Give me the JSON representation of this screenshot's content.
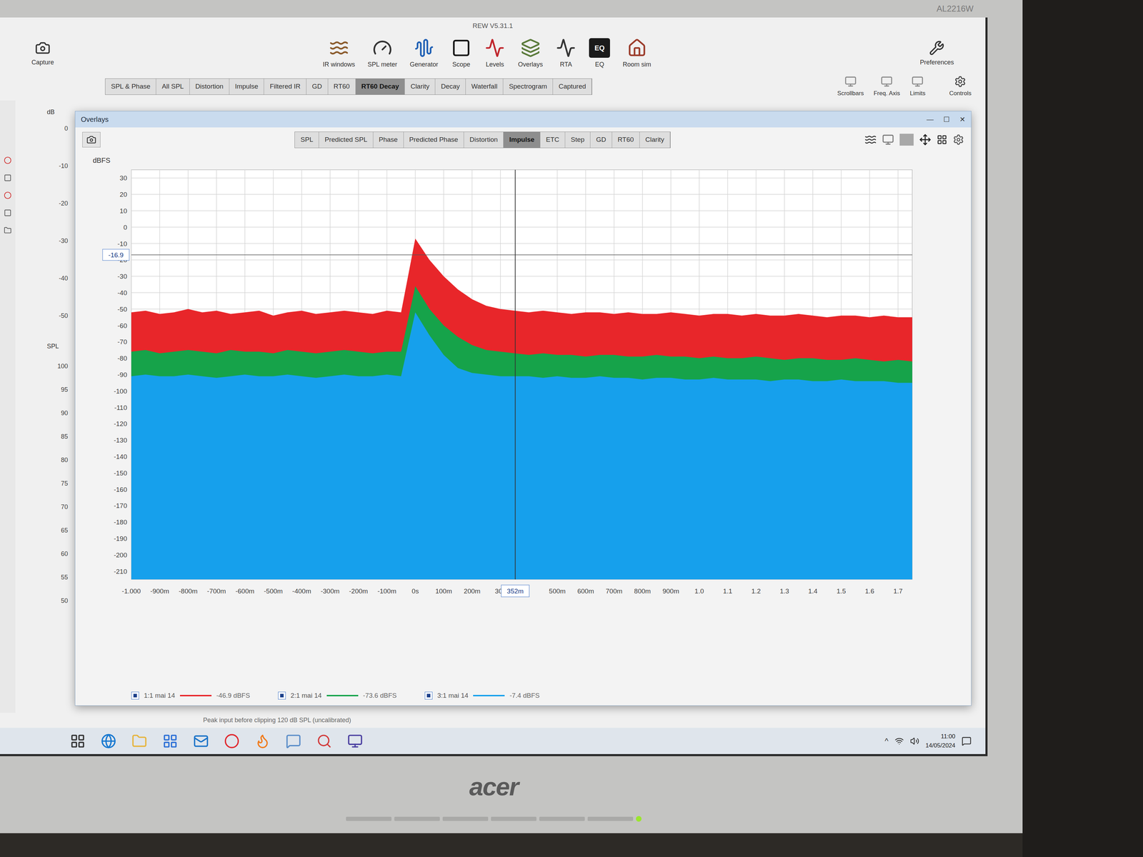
{
  "monitor": {
    "brand": "acer",
    "model": "AL2216W"
  },
  "window": {
    "title": "REW V5.31.1"
  },
  "toolbar": {
    "capture": "Capture",
    "preferences": "Preferences",
    "tools": [
      {
        "label": "IR windows"
      },
      {
        "label": "SPL meter"
      },
      {
        "label": "Generator"
      },
      {
        "label": "Scope"
      },
      {
        "label": "Levels"
      },
      {
        "label": "Overlays"
      },
      {
        "label": "RTA"
      },
      {
        "label": "EQ",
        "badge": "EQ"
      },
      {
        "label": "Room sim"
      }
    ]
  },
  "tabs": [
    {
      "label": "SPL & Phase",
      "selected": false
    },
    {
      "label": "All SPL",
      "selected": false
    },
    {
      "label": "Distortion",
      "selected": false
    },
    {
      "label": "Impulse",
      "selected": false
    },
    {
      "label": "Filtered IR",
      "selected": false
    },
    {
      "label": "GD",
      "selected": false
    },
    {
      "label": "RT60",
      "selected": false
    },
    {
      "label": "RT60 Decay",
      "selected": true
    },
    {
      "label": "Clarity",
      "selected": false
    },
    {
      "label": "Decay",
      "selected": false
    },
    {
      "label": "Waterfall",
      "selected": false
    },
    {
      "label": "Spectrogram",
      "selected": false
    },
    {
      "label": "Captured",
      "selected": false
    }
  ],
  "view_controls": [
    "Scrollbars",
    "Freq. Axis",
    "Limits"
  ],
  "controls": "Controls",
  "side_axis": {
    "unit": "dB",
    "ticks": [
      "0",
      "-10",
      "-20",
      "-30",
      "-40",
      "-50"
    ],
    "spl_label": "SPL",
    "spl_ticks": [
      "100",
      "95",
      "90",
      "85",
      "80",
      "75",
      "70",
      "65",
      "60",
      "55",
      "50"
    ]
  },
  "overlays": {
    "title": "Overlays",
    "window_buttons": [
      "—",
      "☐",
      "✕"
    ],
    "tabs": [
      {
        "label": "SPL",
        "selected": false
      },
      {
        "label": "Predicted SPL",
        "selected": false
      },
      {
        "label": "Phase",
        "selected": false
      },
      {
        "label": "Predicted Phase",
        "selected": false
      },
      {
        "label": "Distortion",
        "selected": false
      },
      {
        "label": "Impulse",
        "selected": true
      },
      {
        "label": "ETC",
        "selected": false
      },
      {
        "label": "Step",
        "selected": false
      },
      {
        "label": "GD",
        "selected": false
      },
      {
        "label": "RT60",
        "selected": false
      },
      {
        "label": "Clarity",
        "selected": false
      }
    ],
    "chart": {
      "y_unit": "dBFS",
      "y_min": -215,
      "y_max": 35,
      "y_ticks": [
        "30",
        "20",
        "10",
        "0",
        "-10",
        "-20",
        "-30",
        "-40",
        "-50",
        "-60",
        "-70",
        "-80",
        "-90",
        "-100",
        "-110",
        "-120",
        "-130",
        "-140",
        "-150",
        "-160",
        "-170",
        "-180",
        "-190",
        "-200",
        "-210"
      ],
      "x_min": -1.0,
      "x_max": 1.75,
      "x_ticks": [
        {
          "label": "-1.000",
          "value": -1.0
        },
        {
          "label": "-900m",
          "value": -0.9
        },
        {
          "label": "-800m",
          "value": -0.8
        },
        {
          "label": "-700m",
          "value": -0.7
        },
        {
          "label": "-600m",
          "value": -0.6
        },
        {
          "label": "-500m",
          "value": -0.5
        },
        {
          "label": "-400m",
          "value": -0.4
        },
        {
          "label": "-300m",
          "value": -0.3
        },
        {
          "label": "-200m",
          "value": -0.2
        },
        {
          "label": "-100m",
          "value": -0.1
        },
        {
          "label": "0s",
          "value": 0.0
        },
        {
          "label": "100m",
          "value": 0.1
        },
        {
          "label": "200m",
          "value": 0.2
        },
        {
          "label": "300",
          "value": 0.3
        },
        {
          "label": "500m",
          "value": 0.5
        },
        {
          "label": "600m",
          "value": 0.6
        },
        {
          "label": "700m",
          "value": 0.7
        },
        {
          "label": "800m",
          "value": 0.8
        },
        {
          "label": "900m",
          "value": 0.9
        },
        {
          "label": "1.0",
          "value": 1.0
        },
        {
          "label": "1.1",
          "value": 1.1
        },
        {
          "label": "1.2",
          "value": 1.2
        },
        {
          "label": "1.3",
          "value": 1.3
        },
        {
          "label": "1.4",
          "value": 1.4
        },
        {
          "label": "1.5",
          "value": 1.5
        },
        {
          "label": "1.6",
          "value": 1.6
        },
        {
          "label": "1.7",
          "value": 1.7
        }
      ],
      "cursor": {
        "x_label": "352m",
        "x": 0.352,
        "y_label": "-16.9",
        "y": -16.9
      },
      "t_start": -1.0,
      "t_step": 0.05,
      "series": [
        {
          "name": "1:1 mai 14",
          "checked": true,
          "color": "#e8262a",
          "value": "-46.9 dBFS",
          "values": [
            -52,
            -51,
            -53,
            -52,
            -50,
            -52,
            -51,
            -53,
            -52,
            -51,
            -54,
            -52,
            -51,
            -53,
            -52,
            -51,
            -52,
            -53,
            -51,
            -52,
            -7,
            -20,
            -30,
            -38,
            -44,
            -48,
            -50,
            -51,
            -52,
            -51,
            -52,
            -53,
            -52,
            -52,
            -53,
            -52,
            -53,
            -53,
            -52,
            -53,
            -54,
            -53,
            -53,
            -54,
            -53,
            -54,
            -54,
            -53,
            -54,
            -55,
            -54,
            -54,
            -55,
            -54,
            -55,
            -55
          ]
        },
        {
          "name": "2:1 mai 14",
          "checked": true,
          "color": "#16a34a",
          "value": "-73.6 dBFS",
          "values": [
            -76,
            -75,
            -77,
            -76,
            -75,
            -76,
            -77,
            -75,
            -76,
            -76,
            -77,
            -75,
            -76,
            -77,
            -76,
            -75,
            -76,
            -77,
            -76,
            -76,
            -36,
            -50,
            -60,
            -67,
            -72,
            -75,
            -76,
            -77,
            -78,
            -77,
            -78,
            -78,
            -79,
            -78,
            -78,
            -79,
            -79,
            -78,
            -79,
            -79,
            -80,
            -79,
            -80,
            -80,
            -79,
            -80,
            -81,
            -80,
            -80,
            -81,
            -81,
            -80,
            -81,
            -82,
            -81,
            -82
          ]
        },
        {
          "name": "3:1 mai 14",
          "checked": true,
          "color": "#16a0ec",
          "value": "-7.4 dBFS",
          "values": [
            -91,
            -90,
            -91,
            -91,
            -90,
            -91,
            -92,
            -91,
            -90,
            -91,
            -91,
            -90,
            -91,
            -92,
            -91,
            -90,
            -91,
            -91,
            -90,
            -91,
            -52,
            -66,
            -78,
            -86,
            -89,
            -90,
            -91,
            -91,
            -91,
            -92,
            -91,
            -92,
            -92,
            -91,
            -92,
            -92,
            -93,
            -92,
            -92,
            -93,
            -93,
            -92,
            -93,
            -93,
            -93,
            -94,
            -93,
            -93,
            -94,
            -94,
            -93,
            -94,
            -94,
            -94,
            -95,
            -95
          ]
        }
      ]
    }
  },
  "status_bar": "Peak input before clipping 120 dB SPL (uncalibrated)",
  "taskbar": {
    "tray_arrow": "^",
    "time": "11:00",
    "date": "14/05/2024"
  }
}
